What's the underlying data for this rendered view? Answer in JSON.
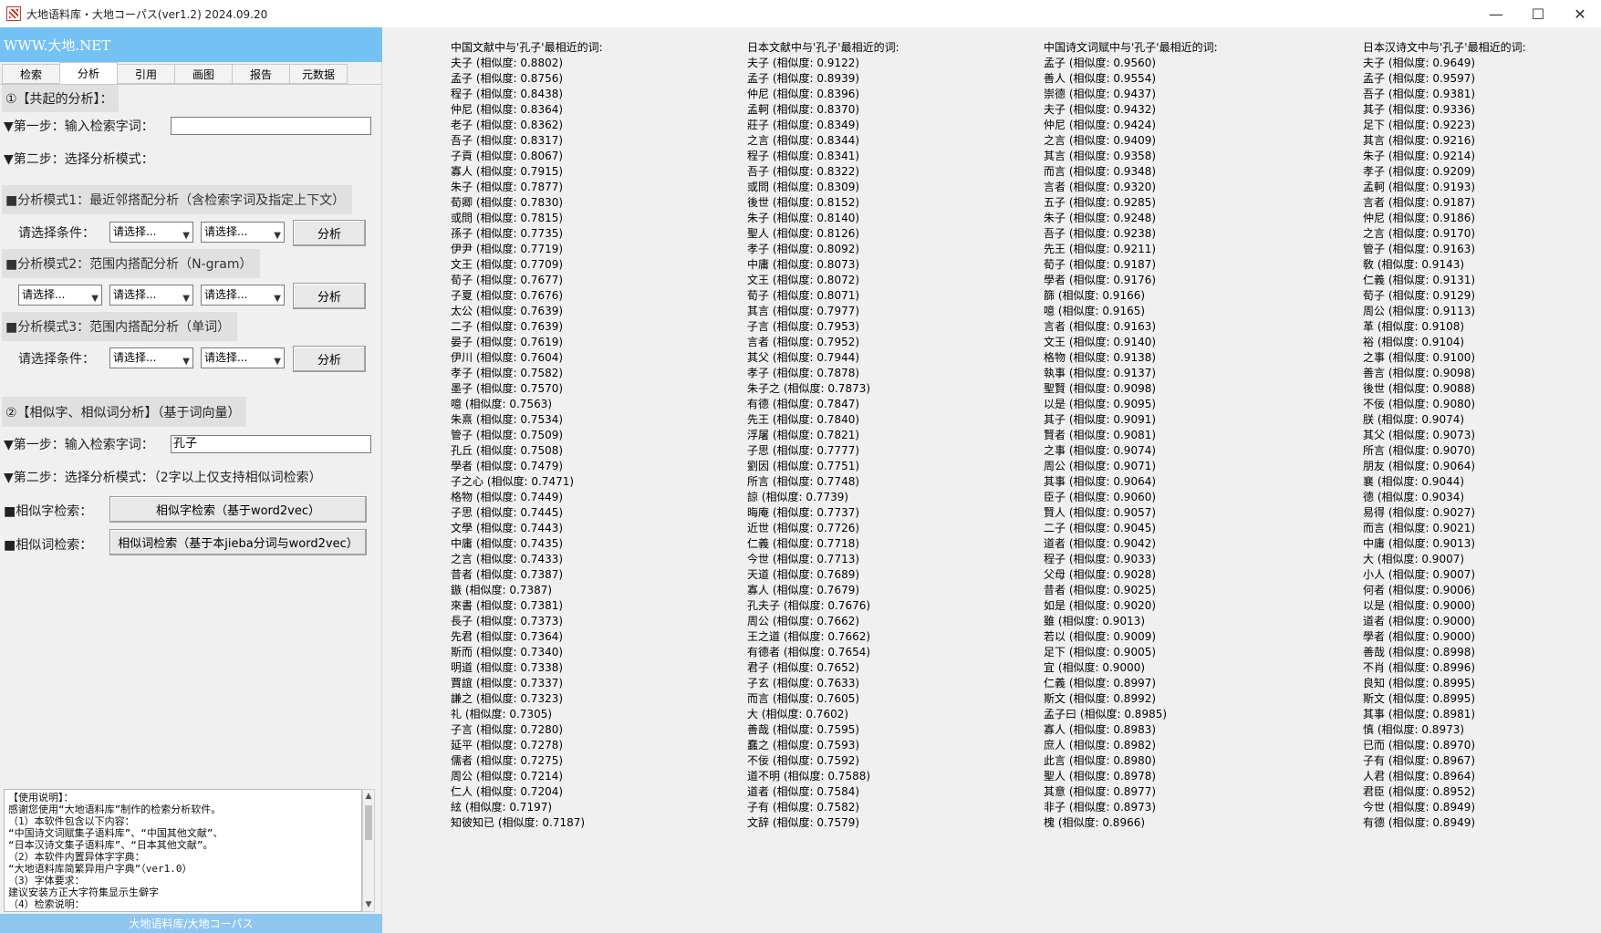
{
  "window": {
    "title": "大地语料库・大地コーパス(ver1.2)  2024.09.20",
    "minimize": "—",
    "maximize": "☐",
    "close": "✕"
  },
  "banner": "WWW.大地.NET",
  "tabs": [
    "检索",
    "分析",
    "引用",
    "画图",
    "报告",
    "元数据"
  ],
  "active_tab": "分析",
  "cooccur": {
    "title": "①【共起的分析】：",
    "step1": "▼第一步：输入检索字词：",
    "step1_value": "",
    "step2": "▼第二步：选择分析模式：",
    "mode1": "■分析模式1：最近邻搭配分析（含检索字词及指定上下文）",
    "mode1_label": "请选择条件：",
    "mode2": "■分析模式2：范围内搭配分析（N-gram）",
    "mode3": "■分析模式3：范围内搭配分析（单词）",
    "mode3_label": "请选择条件：",
    "select_placeholder": "请选择...",
    "analyze_label": "分析"
  },
  "similar": {
    "title": "②【相似字、相似词分析】（基于词向量）",
    "step1": "▼第一步：输入检索字词：",
    "step1_value": "孔子",
    "step2": "▼第二步：选择分析模式：（2字以上仅支持相似词检索）",
    "char_label": "■相似字检索：",
    "char_button": "相似字检索（基于word2vec）",
    "word_label": "■相似词检索：",
    "word_button": "相似词检索（基于本jieba分词与word2vec）"
  },
  "usage_lines": [
    "【使用说明】：",
    "感谢您使用“大地语料库”制作的检索分析软件。",
    "（1）本软件包含以下内容：",
    "“中国诗文词赋集子语料库”、“中国其他文献”、",
    "“日本汉诗文集子语料库”、“日本其他文献”。",
    "（2）本软件内置异体字字典：",
    "“大地语料库简繁异用户字典”（ver1.0）",
    "（3）字体要求：",
    "建议安装方正大字符集显示生僻字",
    "（4）检索说明："
  ],
  "status": "大地语料库/大地コーパス",
  "results": [
    {
      "header": "中国文献中与'孔子'最相近的词:",
      "entries": [
        "夫子 (相似度: 0.8802)",
        "孟子 (相似度: 0.8756)",
        "程子 (相似度: 0.8438)",
        "仲尼 (相似度: 0.8364)",
        "老子 (相似度: 0.8362)",
        "吾子 (相似度: 0.8317)",
        "子貢 (相似度: 0.8067)",
        "寡人 (相似度: 0.7915)",
        "朱子 (相似度: 0.7877)",
        "荀卿 (相似度: 0.7830)",
        "或問 (相似度: 0.7815)",
        "孫子 (相似度: 0.7735)",
        "伊尹 (相似度: 0.7719)",
        "文王 (相似度: 0.7709)",
        "荀子 (相似度: 0.7677)",
        "子夏 (相似度: 0.7676)",
        "太公 (相似度: 0.7639)",
        "二子 (相似度: 0.7639)",
        "晏子 (相似度: 0.7619)",
        "伊川 (相似度: 0.7604)",
        "孝子 (相似度: 0.7582)",
        "墨子 (相似度: 0.7570)",
        "噫 (相似度: 0.7563)",
        "朱熹 (相似度: 0.7534)",
        "管子 (相似度: 0.7509)",
        "孔丘 (相似度: 0.7508)",
        "學者 (相似度: 0.7479)",
        "子之心 (相似度: 0.7471)",
        "格物 (相似度: 0.7449)",
        "子思 (相似度: 0.7445)",
        "文學 (相似度: 0.7443)",
        "中庸 (相似度: 0.7435)",
        "之言 (相似度: 0.7433)",
        "昔者 (相似度: 0.7387)",
        "鏃 (相似度: 0.7387)",
        "來書 (相似度: 0.7381)",
        "長子 (相似度: 0.7373)",
        "先君 (相似度: 0.7364)",
        "斯而 (相似度: 0.7340)",
        "明道 (相似度: 0.7338)",
        "賈誼 (相似度: 0.7337)",
        "謙之 (相似度: 0.7323)",
        "礼 (相似度: 0.7305)",
        "子言 (相似度: 0.7280)",
        "延平 (相似度: 0.7278)",
        "儒者 (相似度: 0.7275)",
        "周公 (相似度: 0.7214)",
        "仁人 (相似度: 0.7204)",
        "絃 (相似度: 0.7197)",
        "知彼知已 (相似度: 0.7187)"
      ]
    },
    {
      "header": "日本文献中与'孔子'最相近的词:",
      "entries": [
        "夫子 (相似度: 0.9122)",
        "孟子 (相似度: 0.8939)",
        "仲尼 (相似度: 0.8396)",
        "孟軻 (相似度: 0.8370)",
        "莊子 (相似度: 0.8349)",
        "之言 (相似度: 0.8344)",
        "程子 (相似度: 0.8341)",
        "吾子 (相似度: 0.8322)",
        "或問 (相似度: 0.8309)",
        "後世 (相似度: 0.8152)",
        "朱子 (相似度: 0.8140)",
        "聖人 (相似度: 0.8126)",
        "孝子 (相似度: 0.8092)",
        "中庸 (相似度: 0.8073)",
        "文王 (相似度: 0.8072)",
        "荀子 (相似度: 0.8071)",
        "其言 (相似度: 0.7977)",
        "子言 (相似度: 0.7953)",
        "言者 (相似度: 0.7952)",
        "其父 (相似度: 0.7944)",
        "孝子 (相似度: 0.7878)",
        "朱子之 (相似度: 0.7873)",
        "有德 (相似度: 0.7847)",
        "先王 (相似度: 0.7840)",
        "浮屠 (相似度: 0.7821)",
        "子思 (相似度: 0.7777)",
        "劉因 (相似度: 0.7751)",
        "所言 (相似度: 0.7748)",
        "諒 (相似度: 0.7739)",
        "晦庵 (相似度: 0.7737)",
        "近世 (相似度: 0.7726)",
        "仁義 (相似度: 0.7718)",
        "今世 (相似度: 0.7713)",
        "天道 (相似度: 0.7689)",
        "寡人 (相似度: 0.7679)",
        "孔夫子 (相似度: 0.7676)",
        "周公 (相似度: 0.7662)",
        "王之道 (相似度: 0.7662)",
        "有德者 (相似度: 0.7654)",
        "君子 (相似度: 0.7652)",
        "子玄 (相似度: 0.7633)",
        "而言 (相似度: 0.7605)",
        "大 (相似度: 0.7602)",
        "善哉 (相似度: 0.7595)",
        "蠢之 (相似度: 0.7593)",
        "不佞 (相似度: 0.7592)",
        "道不明 (相似度: 0.7588)",
        "道者 (相似度: 0.7584)",
        "子有 (相似度: 0.7582)",
        "文辞 (相似度: 0.7579)"
      ]
    },
    {
      "header": "中国诗文词赋中与'孔子'最相近的词:",
      "entries": [
        "孟子 (相似度: 0.9560)",
        "善人 (相似度: 0.9554)",
        "崇德 (相似度: 0.9437)",
        "夫子 (相似度: 0.9432)",
        "仲尼 (相似度: 0.9424)",
        "之言 (相似度: 0.9409)",
        "其言 (相似度: 0.9358)",
        "而言 (相似度: 0.9348)",
        "言者 (相似度: 0.9320)",
        "五子 (相似度: 0.9285)",
        "朱子 (相似度: 0.9248)",
        "吾子 (相似度: 0.9238)",
        "先王 (相似度: 0.9211)",
        "荀子 (相似度: 0.9187)",
        "學者 (相似度: 0.9176)",
        "篩 (相似度: 0.9166)",
        "噫 (相似度: 0.9165)",
        "言者 (相似度: 0.9163)",
        "文王 (相似度: 0.9140)",
        "格物 (相似度: 0.9138)",
        "執事 (相似度: 0.9137)",
        "聖賢 (相似度: 0.9098)",
        "以是 (相似度: 0.9095)",
        "其子 (相似度: 0.9091)",
        "賢者 (相似度: 0.9081)",
        "之事 (相似度: 0.9074)",
        "周公 (相似度: 0.9071)",
        "其事 (相似度: 0.9064)",
        "臣子 (相似度: 0.9060)",
        "賢人 (相似度: 0.9057)",
        "二子 (相似度: 0.9045)",
        "道者 (相似度: 0.9042)",
        "程子 (相似度: 0.9033)",
        "父母 (相似度: 0.9028)",
        "昔者 (相似度: 0.9025)",
        "如是 (相似度: 0.9020)",
        "雖 (相似度: 0.9013)",
        "若以 (相似度: 0.9009)",
        "足下 (相似度: 0.9005)",
        "宜 (相似度: 0.9000)",
        "仁義 (相似度: 0.8997)",
        "斯文 (相似度: 0.8992)",
        "孟子曰 (相似度: 0.8985)",
        "寡人 (相似度: 0.8983)",
        "庶人 (相似度: 0.8982)",
        "此言 (相似度: 0.8980)",
        "聖人 (相似度: 0.8978)",
        "其意 (相似度: 0.8977)",
        "非子 (相似度: 0.8973)",
        "槐 (相似度: 0.8966)"
      ]
    },
    {
      "header": "日本汉诗文中与'孔子'最相近的词:",
      "entries": [
        "夫子 (相似度: 0.9649)",
        "孟子 (相似度: 0.9597)",
        "吾子 (相似度: 0.9381)",
        "其子 (相似度: 0.9336)",
        "足下 (相似度: 0.9223)",
        "其言 (相似度: 0.9216)",
        "朱子 (相似度: 0.9214)",
        "孝子 (相似度: 0.9209)",
        "孟軻 (相似度: 0.9193)",
        "言者 (相似度: 0.9187)",
        "仲尼 (相似度: 0.9186)",
        "之言 (相似度: 0.9170)",
        "管子 (相似度: 0.9163)",
        "敎 (相似度: 0.9143)",
        "仁義 (相似度: 0.9131)",
        "荀子 (相似度: 0.9129)",
        "周公 (相似度: 0.9113)",
        "革 (相似度: 0.9108)",
        "裕 (相似度: 0.9104)",
        "之事 (相似度: 0.9100)",
        "善言 (相似度: 0.9098)",
        "後世 (相似度: 0.9088)",
        "不佞 (相似度: 0.9080)",
        "朕 (相似度: 0.9074)",
        "其父 (相似度: 0.9073)",
        "所言 (相似度: 0.9070)",
        "朋友 (相似度: 0.9064)",
        "襄 (相似度: 0.9044)",
        "德 (相似度: 0.9034)",
        "易得 (相似度: 0.9027)",
        "而言 (相似度: 0.9021)",
        "中庸 (相似度: 0.9013)",
        "大 (相似度: 0.9007)",
        "小人 (相似度: 0.9007)",
        "何者 (相似度: 0.9006)",
        "以是 (相似度: 0.9000)",
        "道者 (相似度: 0.9000)",
        "學者 (相似度: 0.9000)",
        "善哉 (相似度: 0.8998)",
        "不肖 (相似度: 0.8996)",
        "良知 (相似度: 0.8995)",
        "斯文 (相似度: 0.8995)",
        "其事 (相似度: 0.8981)",
        "慎 (相似度: 0.8973)",
        "已而 (相似度: 0.8970)",
        "子有 (相似度: 0.8967)",
        "人君 (相似度: 0.8964)",
        "君臣 (相似度: 0.8952)",
        "今世 (相似度: 0.8949)",
        "有德 (相似度: 0.8949)"
      ]
    }
  ]
}
